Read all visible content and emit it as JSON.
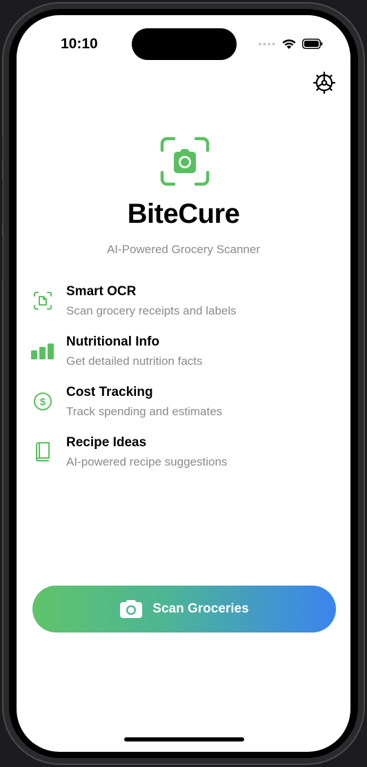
{
  "status_bar": {
    "time": "10:10"
  },
  "settings": {
    "icon": "gear-icon"
  },
  "app": {
    "logo_icon": "camera-viewfinder-icon",
    "title": "BiteCure",
    "subtitle": "AI-Powered Grocery Scanner",
    "accent_color": "#5ac05f"
  },
  "features": [
    {
      "icon": "document-scan-icon",
      "title": "Smart OCR",
      "description": "Scan grocery receipts and labels"
    },
    {
      "icon": "bar-chart-icon",
      "title": "Nutritional Info",
      "description": "Get detailed nutrition facts"
    },
    {
      "icon": "dollar-circle-icon",
      "title": "Cost Tracking",
      "description": "Track spending and estimates"
    },
    {
      "icon": "book-icon",
      "title": "Recipe Ideas",
      "description": "AI-powered recipe suggestions"
    }
  ],
  "scan_button": {
    "icon": "camera-icon",
    "label": "Scan Groceries",
    "gradient_start": "#5fc46a",
    "gradient_end": "#3b84ee"
  }
}
